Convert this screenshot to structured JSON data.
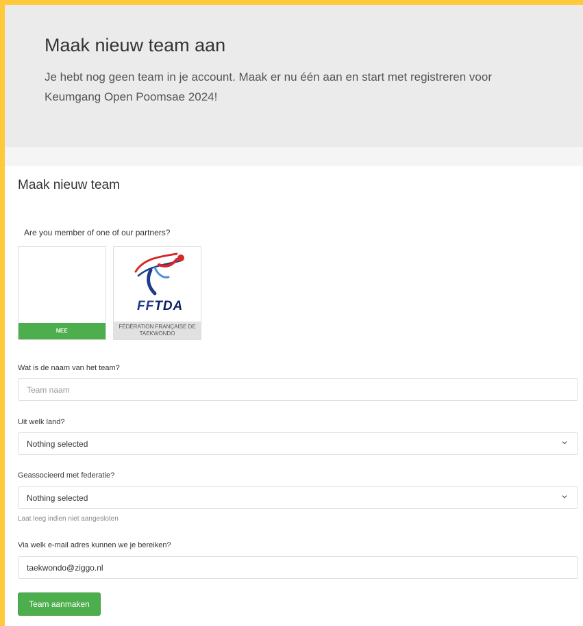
{
  "hero": {
    "title": "Maak nieuw team aan",
    "text": "Je hebt nog geen team in je account. Maak er nu één aan en start met registreren voor Keumgang Open Poomsae 2024!"
  },
  "form": {
    "section_title": "Maak nieuw team",
    "partners_question": "Are you member of one of our partners?",
    "partners": [
      {
        "label": "NEE",
        "selected": true
      },
      {
        "label": "FÉDÉRATION FRANÇAISE DE TAEKWONDO",
        "logo_text": "FFTDA",
        "selected": false
      }
    ],
    "team_name": {
      "label": "Wat is de naam van het team?",
      "placeholder": "Team naam",
      "value": ""
    },
    "country": {
      "label": "Uit welk land?",
      "value": "Nothing selected"
    },
    "federation": {
      "label": "Geassocieerd met federatie?",
      "value": "Nothing selected",
      "help": "Laat leeg indien niet aangesloten"
    },
    "email": {
      "label": "Via welk e-mail adres kunnen we je bereiken?",
      "value": "taekwondo@ziggo.nl"
    },
    "submit_label": "Team aanmaken"
  },
  "colors": {
    "accent_yellow": "#ffc93c",
    "success_green": "#4cae4c",
    "hero_bg": "#ebebeb"
  }
}
